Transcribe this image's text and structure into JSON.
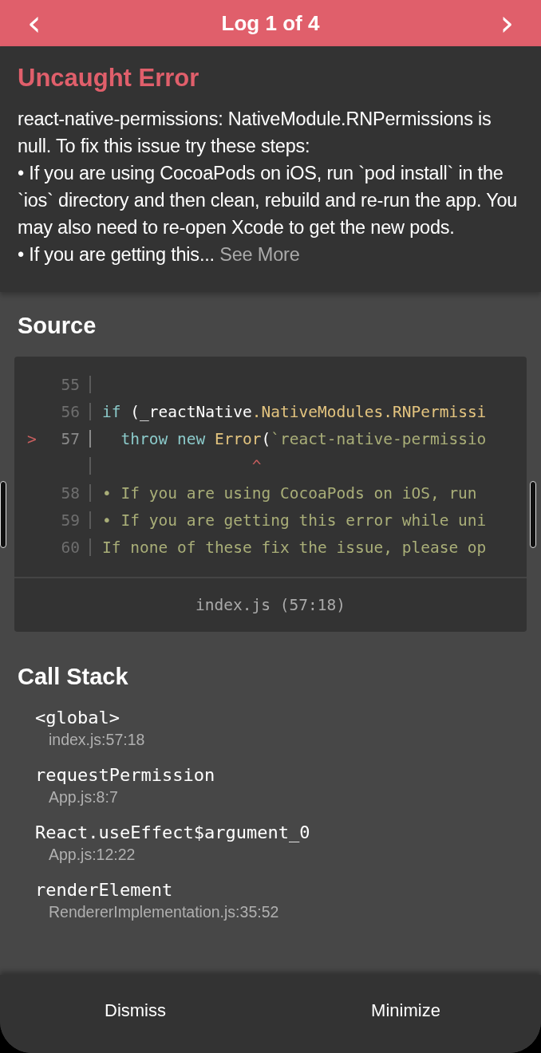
{
  "header": {
    "prev": "‹",
    "title": "Log 1 of 4",
    "next": "›"
  },
  "error": {
    "title": "Uncaught Error",
    "paragraphs": [
      "react-native-permissions: NativeModule.RNPermissions is null. To fix this issue try these steps:",
      "• If you are using CocoaPods on iOS, run `pod install` in the `ios` directory and then clean, rebuild and re-run the app. You may also need to re-open Xcode to get the new pods.",
      "• If you are getting this..."
    ],
    "see_more": "See More"
  },
  "source": {
    "heading": "Source",
    "lines": [
      {
        "number": "55",
        "marker": false
      },
      {
        "number": "56",
        "marker": false,
        "tokens": [
          {
            "kind": "keyword",
            "text": "if"
          },
          {
            "kind": "plain",
            "text": " (_reactNative"
          },
          {
            "kind": "member",
            "text": ".NativeModules.RNPermissi"
          }
        ]
      },
      {
        "number": "57",
        "marker": true,
        "pointer": ">",
        "tokens": [
          {
            "kind": "keyword",
            "text": "  throw new "
          },
          {
            "kind": "member",
            "text": "Error"
          },
          {
            "kind": "plain",
            "text": "("
          },
          {
            "kind": "string",
            "text": "`react-native-permissio"
          }
        ]
      },
      {
        "marker": false,
        "tokens": [
          {
            "kind": "caret",
            "text": "                ^"
          }
        ]
      },
      {
        "number": "58",
        "marker": false,
        "tokens": [
          {
            "kind": "string",
            "text": "• If you are using CocoaPods on iOS, run"
          }
        ]
      },
      {
        "number": "59",
        "marker": false,
        "tokens": [
          {
            "kind": "string",
            "text": "• If you are getting this error while uni"
          }
        ]
      },
      {
        "number": "60",
        "marker": false,
        "tokens": [
          {
            "kind": "string",
            "text": "If none of these fix the issue, please op"
          }
        ]
      }
    ],
    "file": "index.js (57:18)"
  },
  "call_stack": {
    "heading": "Call Stack",
    "frames": [
      {
        "method": "<global>",
        "location": "index.js:57:18"
      },
      {
        "method": "requestPermission",
        "location": "App.js:8:7"
      },
      {
        "method": "React.useEffect$argument_0",
        "location": "App.js:12:22"
      },
      {
        "method": "renderElement",
        "location": "RendererImplementation.js:35:52"
      }
    ]
  },
  "footer": {
    "buttons": [
      "Dismiss",
      "Minimize"
    ]
  }
}
